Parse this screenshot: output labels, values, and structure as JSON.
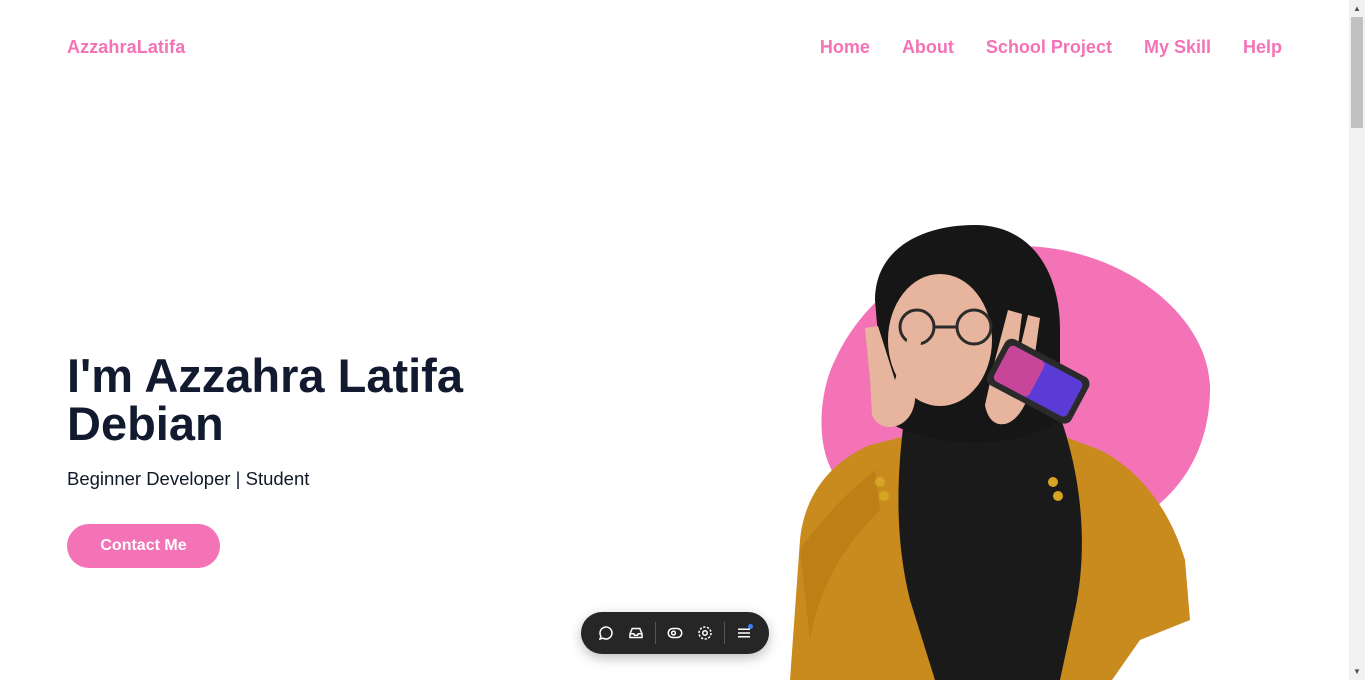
{
  "header": {
    "brand": "AzzahraLatifa",
    "nav": [
      "Home",
      "About",
      "School Project",
      "My Skill",
      "Help"
    ]
  },
  "hero": {
    "title": "I'm Azzahra Latifa Debian",
    "subtitle": "Beginner Developer | Student",
    "cta_label": "Contact Me",
    "image_alt_icon": "portrait-photo"
  },
  "toolbar": {
    "icons": [
      "comment-icon",
      "inbox-icon",
      "eye-icon",
      "view-settings-icon",
      "menu-icon"
    ]
  },
  "colors": {
    "accent": "#f472b6",
    "heading": "#111a2e",
    "toolbar_bg": "#262626",
    "notify_dot": "#3b82f6"
  }
}
